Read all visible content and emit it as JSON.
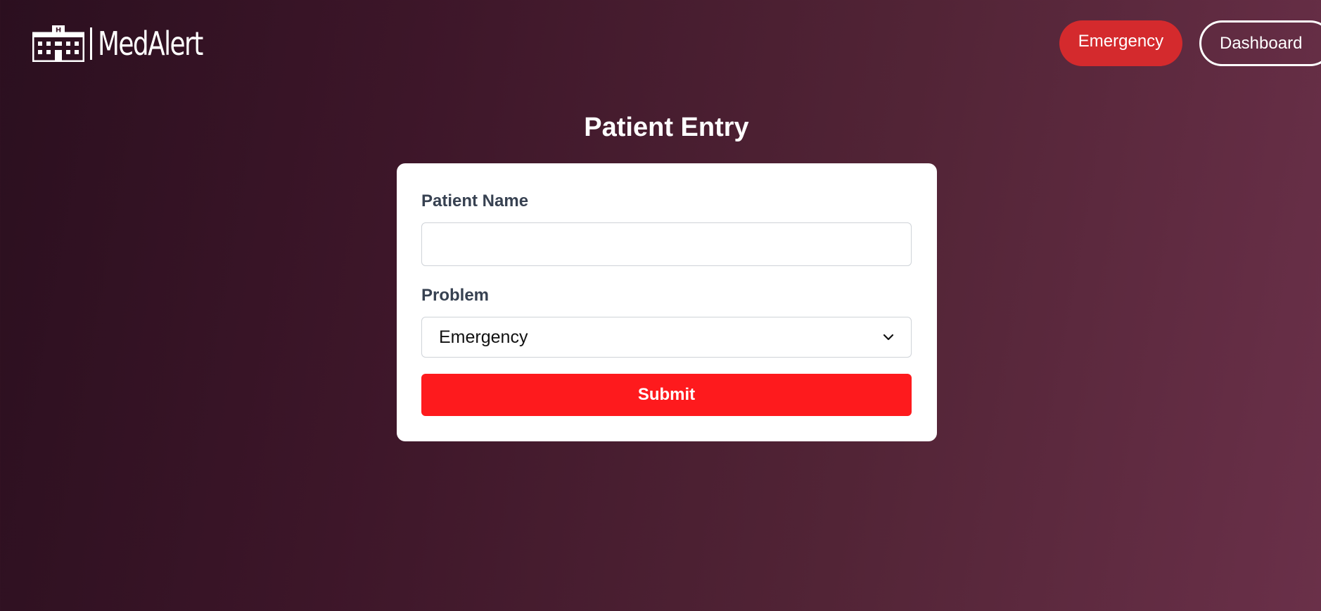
{
  "header": {
    "logo_text": "MedAlert",
    "logo_icon": "hospital-building-icon",
    "emergency_label": "Emergency",
    "dashboard_label": "Dashboard"
  },
  "form": {
    "title": "Patient Entry",
    "patient_name_label": "Patient Name",
    "patient_name_value": "",
    "problem_label": "Problem",
    "problem_selected": "Emergency",
    "submit_label": "Submit"
  },
  "colors": {
    "emergency_button": "#d42a2d",
    "submit_button": "#fe1a1d",
    "label_text": "#374151"
  }
}
